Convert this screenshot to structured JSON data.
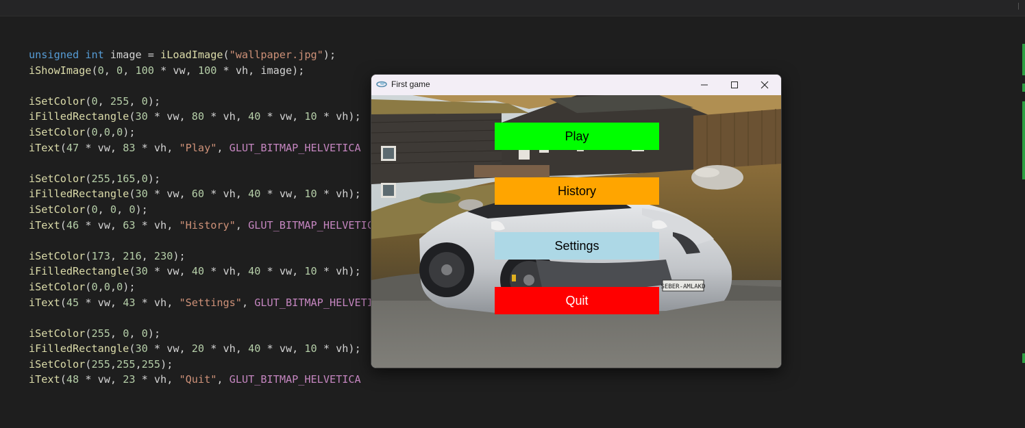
{
  "editor": {
    "lines": [
      [
        {
          "t": "unsigned",
          "c": "kw"
        },
        {
          "t": " "
        },
        {
          "t": "int",
          "c": "kw"
        },
        {
          "t": " image = "
        },
        {
          "t": "iLoadImage",
          "c": "fn"
        },
        {
          "t": "("
        },
        {
          "t": "\"wallpaper.jpg\"",
          "c": "str"
        },
        {
          "t": ");"
        }
      ],
      [
        {
          "t": "iShowImage",
          "c": "fn"
        },
        {
          "t": "("
        },
        {
          "t": "0",
          "c": "num"
        },
        {
          "t": ", "
        },
        {
          "t": "0",
          "c": "num"
        },
        {
          "t": ", "
        },
        {
          "t": "100",
          "c": "num"
        },
        {
          "t": " * vw, "
        },
        {
          "t": "100",
          "c": "num"
        },
        {
          "t": " * vh, image);"
        }
      ],
      [],
      [
        {
          "t": "iSetColor",
          "c": "fn"
        },
        {
          "t": "("
        },
        {
          "t": "0",
          "c": "num"
        },
        {
          "t": ", "
        },
        {
          "t": "255",
          "c": "num"
        },
        {
          "t": ", "
        },
        {
          "t": "0",
          "c": "num"
        },
        {
          "t": ");"
        }
      ],
      [
        {
          "t": "iFilledRectangle",
          "c": "fn"
        },
        {
          "t": "("
        },
        {
          "t": "30",
          "c": "num"
        },
        {
          "t": " * vw, "
        },
        {
          "t": "80",
          "c": "num"
        },
        {
          "t": " * vh, "
        },
        {
          "t": "40",
          "c": "num"
        },
        {
          "t": " * vw, "
        },
        {
          "t": "10",
          "c": "num"
        },
        {
          "t": " * vh);"
        }
      ],
      [
        {
          "t": "iSetColor",
          "c": "fn"
        },
        {
          "t": "("
        },
        {
          "t": "0",
          "c": "num"
        },
        {
          "t": ","
        },
        {
          "t": "0",
          "c": "num"
        },
        {
          "t": ","
        },
        {
          "t": "0",
          "c": "num"
        },
        {
          "t": ");"
        }
      ],
      [
        {
          "t": "iText",
          "c": "fn"
        },
        {
          "t": "("
        },
        {
          "t": "47",
          "c": "num"
        },
        {
          "t": " * vw, "
        },
        {
          "t": "83",
          "c": "num"
        },
        {
          "t": " * vh, "
        },
        {
          "t": "\"Play\"",
          "c": "str"
        },
        {
          "t": ", "
        },
        {
          "t": "GLUT_BITMAP_HELVETICA",
          "c": "mac"
        }
      ],
      [],
      [
        {
          "t": "iSetColor",
          "c": "fn"
        },
        {
          "t": "("
        },
        {
          "t": "255",
          "c": "num"
        },
        {
          "t": ","
        },
        {
          "t": "165",
          "c": "num"
        },
        {
          "t": ","
        },
        {
          "t": "0",
          "c": "num"
        },
        {
          "t": ");"
        }
      ],
      [
        {
          "t": "iFilledRectangle",
          "c": "fn"
        },
        {
          "t": "("
        },
        {
          "t": "30",
          "c": "num"
        },
        {
          "t": " * vw, "
        },
        {
          "t": "60",
          "c": "num"
        },
        {
          "t": " * vh, "
        },
        {
          "t": "40",
          "c": "num"
        },
        {
          "t": " * vw, "
        },
        {
          "t": "10",
          "c": "num"
        },
        {
          "t": " * vh);"
        }
      ],
      [
        {
          "t": "iSetColor",
          "c": "fn"
        },
        {
          "t": "("
        },
        {
          "t": "0",
          "c": "num"
        },
        {
          "t": ", "
        },
        {
          "t": "0",
          "c": "num"
        },
        {
          "t": ", "
        },
        {
          "t": "0",
          "c": "num"
        },
        {
          "t": ");"
        }
      ],
      [
        {
          "t": "iText",
          "c": "fn"
        },
        {
          "t": "("
        },
        {
          "t": "46",
          "c": "num"
        },
        {
          "t": " * vw, "
        },
        {
          "t": "63",
          "c": "num"
        },
        {
          "t": " * vh, "
        },
        {
          "t": "\"History\"",
          "c": "str"
        },
        {
          "t": ", "
        },
        {
          "t": "GLUT_BITMAP_HELVETICA",
          "c": "mac"
        }
      ],
      [],
      [
        {
          "t": "iSetColor",
          "c": "fn"
        },
        {
          "t": "("
        },
        {
          "t": "173",
          "c": "num"
        },
        {
          "t": ", "
        },
        {
          "t": "216",
          "c": "num"
        },
        {
          "t": ", "
        },
        {
          "t": "230",
          "c": "num"
        },
        {
          "t": ");"
        }
      ],
      [
        {
          "t": "iFilledRectangle",
          "c": "fn"
        },
        {
          "t": "("
        },
        {
          "t": "30",
          "c": "num"
        },
        {
          "t": " * vw, "
        },
        {
          "t": "40",
          "c": "num"
        },
        {
          "t": " * vh, "
        },
        {
          "t": "40",
          "c": "num"
        },
        {
          "t": " * vw, "
        },
        {
          "t": "10",
          "c": "num"
        },
        {
          "t": " * vh);"
        }
      ],
      [
        {
          "t": "iSetColor",
          "c": "fn"
        },
        {
          "t": "("
        },
        {
          "t": "0",
          "c": "num"
        },
        {
          "t": ","
        },
        {
          "t": "0",
          "c": "num"
        },
        {
          "t": ","
        },
        {
          "t": "0",
          "c": "num"
        },
        {
          "t": ");"
        }
      ],
      [
        {
          "t": "iText",
          "c": "fn"
        },
        {
          "t": "("
        },
        {
          "t": "45",
          "c": "num"
        },
        {
          "t": " * vw, "
        },
        {
          "t": "43",
          "c": "num"
        },
        {
          "t": " * vh, "
        },
        {
          "t": "\"Settings\"",
          "c": "str"
        },
        {
          "t": ", "
        },
        {
          "t": "GLUT_BITMAP_HELVETICA",
          "c": "mac"
        }
      ],
      [],
      [
        {
          "t": "iSetColor",
          "c": "fn"
        },
        {
          "t": "("
        },
        {
          "t": "255",
          "c": "num"
        },
        {
          "t": ", "
        },
        {
          "t": "0",
          "c": "num"
        },
        {
          "t": ", "
        },
        {
          "t": "0",
          "c": "num"
        },
        {
          "t": ");"
        }
      ],
      [
        {
          "t": "iFilledRectangle",
          "c": "fn"
        },
        {
          "t": "("
        },
        {
          "t": "30",
          "c": "num"
        },
        {
          "t": " * vw, "
        },
        {
          "t": "20",
          "c": "num"
        },
        {
          "t": " * vh, "
        },
        {
          "t": "40",
          "c": "num"
        },
        {
          "t": " * vw, "
        },
        {
          "t": "10",
          "c": "num"
        },
        {
          "t": " * vh);"
        }
      ],
      [
        {
          "t": "iSetColor",
          "c": "fn"
        },
        {
          "t": "("
        },
        {
          "t": "255",
          "c": "num"
        },
        {
          "t": ","
        },
        {
          "t": "255",
          "c": "num"
        },
        {
          "t": ","
        },
        {
          "t": "255",
          "c": "num"
        },
        {
          "t": ");"
        }
      ],
      [
        {
          "t": "iText",
          "c": "fn"
        },
        {
          "t": "("
        },
        {
          "t": "48",
          "c": "num"
        },
        {
          "t": " * vw, "
        },
        {
          "t": "23",
          "c": "num"
        },
        {
          "t": " * vh, "
        },
        {
          "t": "\"Quit\"",
          "c": "str"
        },
        {
          "t": ", "
        },
        {
          "t": "GLUT_BITMAP_HELVETICA",
          "c": "mac"
        }
      ]
    ],
    "closing_brace": "}"
  },
  "game_window": {
    "title": "First game",
    "app_icon": "opengl-app-icon",
    "controls": {
      "minimize_icon": "minimize-icon",
      "maximize_icon": "maximize-icon",
      "close_icon": "close-icon"
    },
    "background_image": "wallpaper.jpg",
    "buttons": {
      "play": {
        "label": "Play",
        "color": "#00ff00",
        "text_color": "#000000"
      },
      "history": {
        "label": "History",
        "color": "#ffa500",
        "text_color": "#000000"
      },
      "settings": {
        "label": "Settings",
        "color": "#add8e6",
        "text_color": "#000000"
      },
      "quit": {
        "label": "Quit",
        "color": "#ff0000",
        "text_color": "#ffffff"
      }
    }
  },
  "colors": {
    "editor_bg": "#1e1e1e",
    "keyword": "#569cd6",
    "string": "#ce9178",
    "function": "#dcdcaa",
    "number": "#b5cea8",
    "macro": "#c586c0",
    "scroll_marker": "#2ea043"
  }
}
